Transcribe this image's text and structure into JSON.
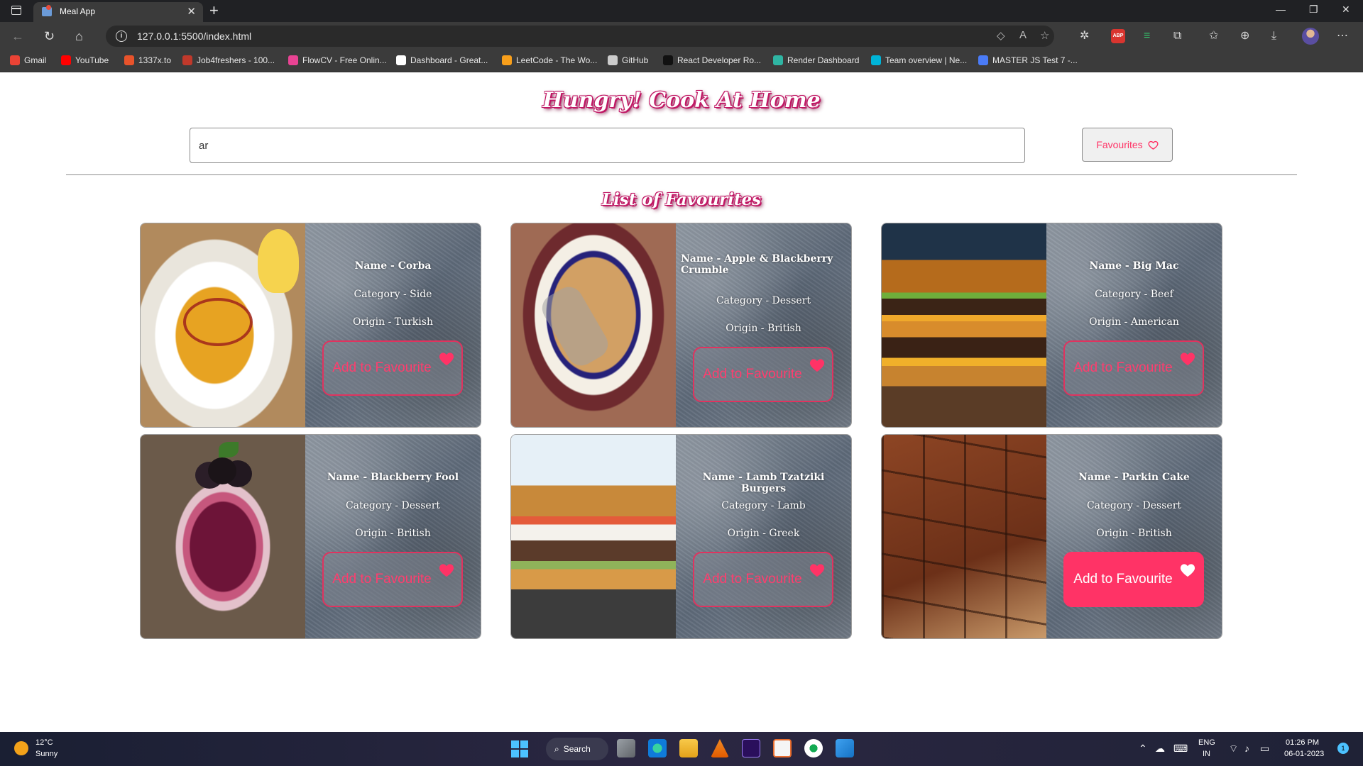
{
  "browser": {
    "tab_title": "Meal App",
    "tab_close": "✕",
    "new_tab": "+",
    "url": "127.0.0.1:5500/index.html",
    "window_controls": {
      "minimize": "—",
      "restore": "❐",
      "close": "✕"
    },
    "bookmarks": [
      {
        "label": "Gmail",
        "color": "#ea4335"
      },
      {
        "label": "YouTube",
        "color": "#ff0000"
      },
      {
        "label": "1337x.to",
        "color": "#e8532b"
      },
      {
        "label": "Job4freshers - 100...",
        "color": "#c0392b"
      },
      {
        "label": "FlowCV - Free Onlin...",
        "color": "#e84393"
      },
      {
        "label": "Dashboard - Great...",
        "color": "#ffffff"
      },
      {
        "label": "LeetCode - The Wo...",
        "color": "#f89f1b"
      },
      {
        "label": "GitHub",
        "color": "#cccccc"
      },
      {
        "label": "React Developer Ro...",
        "color": "#111111"
      },
      {
        "label": "Render Dashboard",
        "color": "#2fb5a3"
      },
      {
        "label": "Team overview | Ne...",
        "color": "#00b4d8"
      },
      {
        "label": "MASTER JS Test 7 -...",
        "color": "#4a7bf7"
      }
    ]
  },
  "app": {
    "title": "Hungry! Cook At Home",
    "search_value": "ar",
    "favourites_button": "Favourites",
    "section_title": "List of Favourites",
    "meals": [
      {
        "name": "Name - Corba",
        "category": "Category - Side",
        "origin": "Origin - Turkish",
        "button": "Add to Favourite",
        "image": "soup-bowl"
      },
      {
        "name": "Name - Apple & Blackberry Crumble",
        "category": "Category - Dessert",
        "origin": "Origin - British",
        "button": "Add to Favourite",
        "image": "crumble-dish"
      },
      {
        "name": "Name - Big Mac",
        "category": "Category - Beef",
        "origin": "Origin - American",
        "button": "Add to Favourite",
        "image": "double-burger"
      },
      {
        "name": "Name - Blackberry Fool",
        "category": "Category - Dessert",
        "origin": "Origin - British",
        "button": "Add to Favourite",
        "image": "berry-glass"
      },
      {
        "name": "Name - Lamb Tzatziki Burgers",
        "category": "Category - Lamb",
        "origin": "Origin - Greek",
        "button": "Add to Favourite",
        "image": "lamb-burger"
      },
      {
        "name": "Name - Parkin Cake",
        "category": "Category - Dessert",
        "origin": "Origin - British",
        "button": "Add to Favourite",
        "image": "parkin-cake"
      }
    ],
    "accent_color": "#ff3366"
  },
  "taskbar": {
    "temperature": "12°C",
    "weather": "Sunny",
    "search_label": "Search",
    "language": "ENG",
    "region": "IN",
    "time": "01:26 PM",
    "date": "06-01-2023",
    "notifications": "1"
  }
}
